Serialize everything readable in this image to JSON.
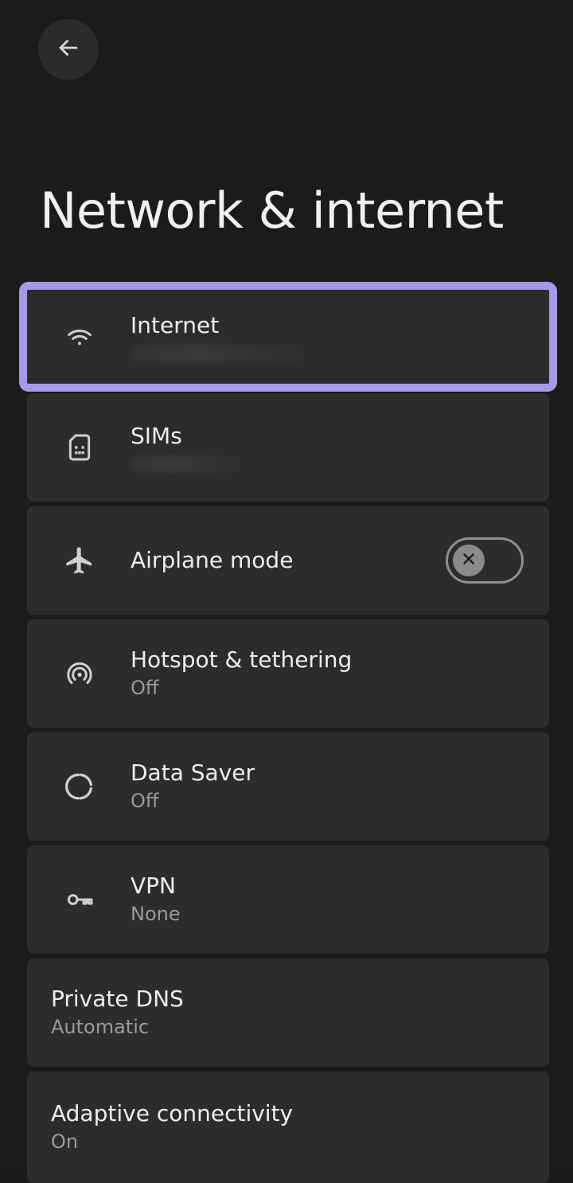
{
  "header": {
    "back_icon": "arrow-left-icon",
    "title": "Network & internet"
  },
  "items": [
    {
      "id": "internet",
      "icon": "wifi-icon",
      "title": "Internet",
      "summary": "",
      "selected": true
    },
    {
      "id": "sims",
      "icon": "sim-card-icon",
      "title": "SIMs",
      "summary": ""
    },
    {
      "id": "airplane",
      "icon": "airplane-icon",
      "title": "Airplane mode",
      "toggle": false
    },
    {
      "id": "hotspot",
      "icon": "hotspot-icon",
      "title": "Hotspot & tethering",
      "summary": "Off"
    },
    {
      "id": "data-saver",
      "icon": "data-saver-icon",
      "title": "Data Saver",
      "summary": "Off"
    },
    {
      "id": "vpn",
      "icon": "key-icon",
      "title": "VPN",
      "summary": "None"
    },
    {
      "id": "private-dns",
      "title": "Private DNS",
      "summary": "Automatic"
    },
    {
      "id": "adaptive",
      "title": "Adaptive connectivity",
      "summary": "On"
    }
  ],
  "colors": {
    "background": "#1b1b1b",
    "card": "#2c2c2c",
    "highlight": "#A69AE8",
    "primary_text": "#EDEDED",
    "secondary_text": "#9A9A9A"
  }
}
